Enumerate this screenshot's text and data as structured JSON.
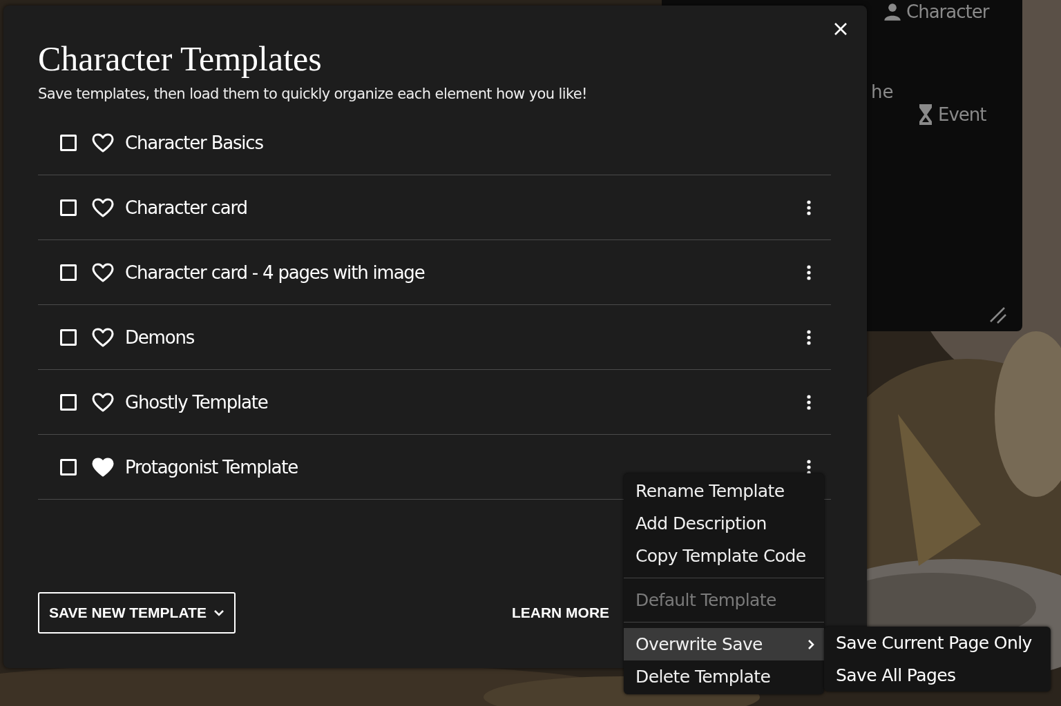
{
  "background_panel": {
    "items": [
      {
        "kind": "character",
        "label": "Character"
      },
      {
        "kind": "text",
        "label": "he"
      },
      {
        "kind": "event",
        "label": "Event"
      }
    ]
  },
  "dialog": {
    "title": "Character Templates",
    "subtitle": "Save templates, then load them to quickly organize each element how you like!",
    "templates": [
      {
        "name": "Character Basics",
        "checked": false,
        "favorite": false,
        "has_menu": false
      },
      {
        "name": "Character card",
        "checked": false,
        "favorite": false,
        "has_menu": true
      },
      {
        "name": "Character card - 4 pages with image",
        "checked": false,
        "favorite": false,
        "has_menu": true
      },
      {
        "name": "Demons",
        "checked": false,
        "favorite": false,
        "has_menu": true
      },
      {
        "name": "Ghostly Template",
        "checked": false,
        "favorite": false,
        "has_menu": true
      },
      {
        "name": "Protagonist Template",
        "checked": false,
        "favorite": true,
        "has_menu": true
      }
    ],
    "save_button": "SAVE NEW TEMPLATE",
    "learn_more": "LEARN MORE"
  },
  "context_menu": {
    "groups": [
      [
        {
          "label": "Rename Template",
          "disabled": false,
          "selected": false,
          "submenu": false
        },
        {
          "label": "Add Description",
          "disabled": false,
          "selected": false,
          "submenu": false
        },
        {
          "label": "Copy Template Code",
          "disabled": false,
          "selected": false,
          "submenu": false
        }
      ],
      [
        {
          "label": "Default Template",
          "disabled": true,
          "selected": false,
          "submenu": false
        }
      ],
      [
        {
          "label": "Overwrite Save",
          "disabled": false,
          "selected": true,
          "submenu": true
        },
        {
          "label": "Delete Template",
          "disabled": false,
          "selected": false,
          "submenu": false
        }
      ]
    ],
    "submenu": [
      {
        "label": "Save Current Page Only"
      },
      {
        "label": "Save All Pages"
      }
    ]
  }
}
